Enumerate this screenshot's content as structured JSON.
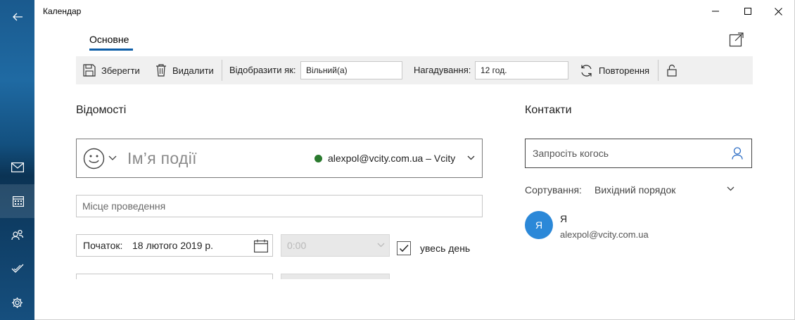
{
  "window": {
    "title": "Календар",
    "minimize_icon": "minimize-icon",
    "maximize_icon": "maximize-icon",
    "close_icon": "close-icon"
  },
  "rail": {
    "items": [
      "back-arrow-icon",
      "mail-icon",
      "calendar-icon",
      "people-icon",
      "tasks-icon",
      "settings-icon"
    ]
  },
  "tabs": [
    {
      "label": "Основне",
      "active": true
    }
  ],
  "toolbar": {
    "save_label": "Зберегти",
    "delete_label": "Видалити",
    "show_as_label": "Відобразити як:",
    "show_as_value": "Вільний(а)",
    "reminder_label": "Нагадування:",
    "reminder_value": "12 год.",
    "repeat_label": "Повторення"
  },
  "details": {
    "section_title": "Відомості",
    "event_name_placeholder": "Ім’я події",
    "calendar_account": "alexpol@vcity.com.ua – Vcity",
    "calendar_color": "#2a7a2e",
    "location_placeholder": "Місце проведення",
    "start_label": "Початок:",
    "start_date": "18 лютого 2019 р.",
    "start_time": "0:00",
    "all_day_label": "увесь день",
    "all_day_checked": true
  },
  "contacts": {
    "section_title": "Контакти",
    "invite_placeholder": "Запросіть когось",
    "sort_label": "Сортування:",
    "sort_value": "Вихідний порядок",
    "attendees": [
      {
        "initial": "Я",
        "name": "Я",
        "email": "alexpol@vcity.com.ua"
      }
    ]
  },
  "colors": {
    "accent": "#0e5ea8",
    "avatar": "#2b88d8"
  }
}
